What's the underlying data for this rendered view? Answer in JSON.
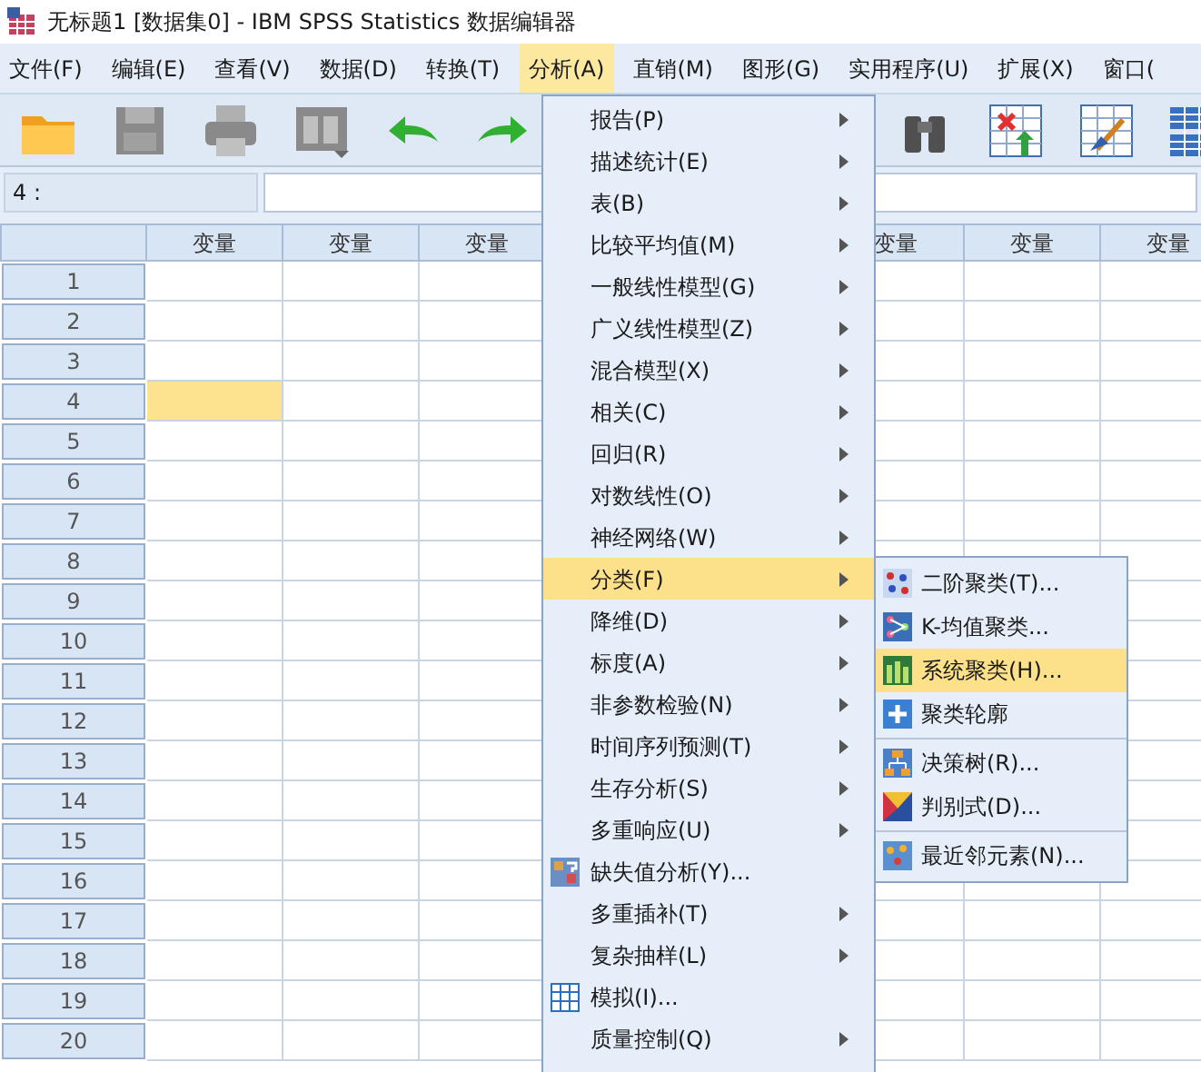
{
  "window": {
    "title": "无标题1 [数据集0] - IBM SPSS Statistics 数据编辑器"
  },
  "menu_bar": [
    {
      "label": "文件(F)",
      "selected": false
    },
    {
      "label": "编辑(E)",
      "selected": false
    },
    {
      "label": "查看(V)",
      "selected": false
    },
    {
      "label": "数据(D)",
      "selected": false
    },
    {
      "label": "转换(T)",
      "selected": false
    },
    {
      "label": "分析(A)",
      "selected": true
    },
    {
      "label": "直销(M)",
      "selected": false
    },
    {
      "label": "图形(G)",
      "selected": false
    },
    {
      "label": "实用程序(U)",
      "selected": false
    },
    {
      "label": "扩展(X)",
      "selected": false
    },
    {
      "label": "窗口(",
      "selected": false
    }
  ],
  "cell_editor": {
    "reference": "4 :"
  },
  "grid": {
    "columns_left": [
      "变量",
      "变量",
      "变量"
    ],
    "columns_right": [
      "变量",
      "变量",
      "变量"
    ],
    "rows": [
      {
        "label": "1",
        "selected": false
      },
      {
        "label": "2",
        "selected": false
      },
      {
        "label": "3",
        "selected": false
      },
      {
        "label": "4",
        "selected": true
      },
      {
        "label": "5",
        "selected": false
      },
      {
        "label": "6",
        "selected": false
      },
      {
        "label": "7",
        "selected": false
      },
      {
        "label": "8",
        "selected": false
      },
      {
        "label": "9",
        "selected": false
      },
      {
        "label": "10",
        "selected": false
      },
      {
        "label": "11",
        "selected": false
      },
      {
        "label": "12",
        "selected": false
      },
      {
        "label": "13",
        "selected": false
      },
      {
        "label": "14",
        "selected": false
      },
      {
        "label": "15",
        "selected": false
      },
      {
        "label": "16",
        "selected": false
      },
      {
        "label": "17",
        "selected": false
      },
      {
        "label": "18",
        "selected": false
      },
      {
        "label": "19",
        "selected": false
      },
      {
        "label": "20",
        "selected": false
      }
    ]
  },
  "analyze_menu": [
    {
      "label": "报告(P)",
      "kind": "submenu",
      "selected": false
    },
    {
      "label": "描述统计(E)",
      "kind": "submenu",
      "selected": false
    },
    {
      "label": "表(B)",
      "kind": "submenu",
      "selected": false
    },
    {
      "label": "比较平均值(M)",
      "kind": "submenu",
      "selected": false
    },
    {
      "label": "一般线性模型(G)",
      "kind": "submenu",
      "selected": false
    },
    {
      "label": "广义线性模型(Z)",
      "kind": "submenu",
      "selected": false
    },
    {
      "label": "混合模型(X)",
      "kind": "submenu",
      "selected": false
    },
    {
      "label": "相关(C)",
      "kind": "submenu",
      "selected": false
    },
    {
      "label": "回归(R)",
      "kind": "submenu",
      "selected": false
    },
    {
      "label": "对数线性(O)",
      "kind": "submenu",
      "selected": false
    },
    {
      "label": "神经网络(W)",
      "kind": "submenu",
      "selected": false
    },
    {
      "label": "分类(F)",
      "kind": "submenu",
      "selected": true
    },
    {
      "label": "降维(D)",
      "kind": "submenu",
      "selected": false
    },
    {
      "label": "标度(A)",
      "kind": "submenu",
      "selected": false
    },
    {
      "label": "非参数检验(N)",
      "kind": "submenu",
      "selected": false
    },
    {
      "label": "时间序列预测(T)",
      "kind": "submenu",
      "selected": false
    },
    {
      "label": "生存分析(S)",
      "kind": "submenu",
      "selected": false
    },
    {
      "label": "多重响应(U)",
      "kind": "submenu",
      "selected": false
    },
    {
      "label": "缺失值分析(Y)...",
      "kind": "missing",
      "selected": false
    },
    {
      "label": "多重插补(T)",
      "kind": "submenu",
      "selected": false
    },
    {
      "label": "复杂抽样(L)",
      "kind": "submenu",
      "selected": false
    },
    {
      "label": "模拟(I)...",
      "kind": "simulation",
      "selected": false
    },
    {
      "label": "质量控制(Q)",
      "kind": "submenu",
      "selected": false
    }
  ],
  "classify_menu": [
    {
      "label": "二阶聚类(T)...",
      "kind": "twostep",
      "selected": false,
      "separator_before": false
    },
    {
      "label": "K-均值聚类...",
      "kind": "kmeans",
      "selected": false,
      "separator_before": false
    },
    {
      "label": "系统聚类(H)...",
      "kind": "hierarchical",
      "selected": true,
      "separator_before": false
    },
    {
      "label": "聚类轮廓",
      "kind": "silhouette",
      "selected": false,
      "separator_before": false
    },
    {
      "label": "决策树(R)...",
      "kind": "tree",
      "selected": false,
      "separator_before": true
    },
    {
      "label": "判别式(D)...",
      "kind": "discriminant",
      "selected": false,
      "separator_before": false
    },
    {
      "label": "最近邻元素(N)...",
      "kind": "nearest",
      "selected": false,
      "separator_before": true
    }
  ]
}
